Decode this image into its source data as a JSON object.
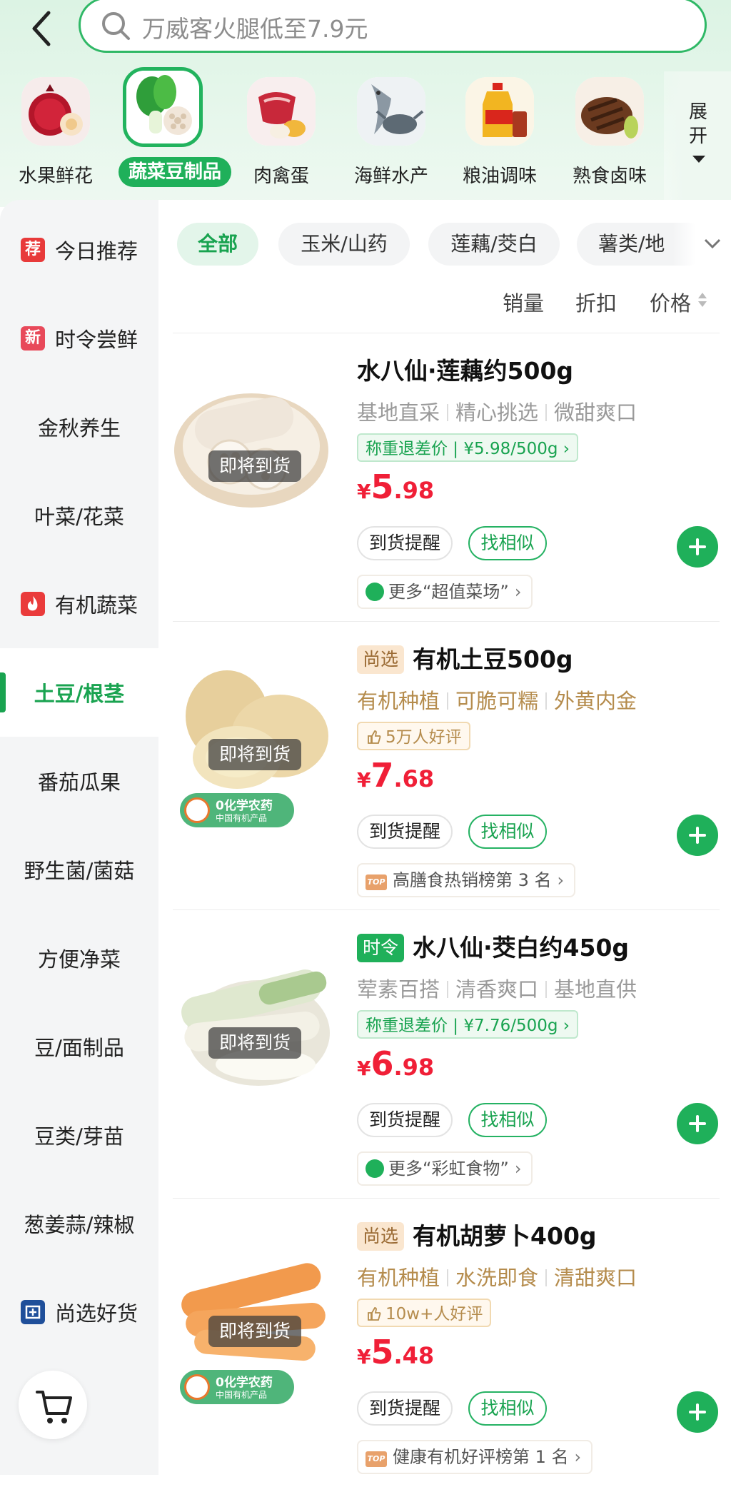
{
  "search": {
    "placeholder": "万威客火腿低至7.9元"
  },
  "categories": [
    {
      "label": "水果鲜花",
      "icon": "pomegranate-icon"
    },
    {
      "label": "蔬菜豆制品",
      "icon": "bok-choy-icon",
      "active": true
    },
    {
      "label": "肉禽蛋",
      "icon": "meat-icon"
    },
    {
      "label": "海鲜水产",
      "icon": "fish-icon"
    },
    {
      "label": "粮油调味",
      "icon": "oil-icon"
    },
    {
      "label": "熟食卤味",
      "icon": "braised-food-icon"
    }
  ],
  "expand": {
    "line1": "展",
    "line2": "开"
  },
  "sidebar": {
    "items": [
      {
        "label": "今日推荐",
        "badge": "荐"
      },
      {
        "label": "时令尝鲜",
        "badge": "新"
      },
      {
        "label": "金秋养生"
      },
      {
        "label": "叶菜/花菜"
      },
      {
        "label": "有机蔬菜",
        "badge": "fire"
      },
      {
        "label": "土豆/根茎",
        "active": true
      },
      {
        "label": "番茄瓜果"
      },
      {
        "label": "野生菌/菌菇"
      },
      {
        "label": "方便净菜"
      },
      {
        "label": "豆/面制品"
      },
      {
        "label": "豆类/芽苗"
      },
      {
        "label": "葱姜蒜/辣椒"
      },
      {
        "label": "尚选好货",
        "badge": "box"
      }
    ]
  },
  "filters": {
    "chips": [
      "全部",
      "玉米/山药",
      "莲藕/茭白",
      "薯类/地"
    ],
    "sorts": [
      "销量",
      "折扣",
      "价格"
    ]
  },
  "products": [
    {
      "title": "水八仙·莲藕约500g",
      "tag": "",
      "desc": [
        "基地直采",
        "精心挑选",
        "微甜爽口"
      ],
      "pill": "称重退差价 | ¥5.98/500g",
      "pill_style": "green",
      "price_symbol": "¥",
      "price_int": "5",
      "price_dec": ".98",
      "status": "即将到货",
      "notify": "到货提醒",
      "similar": "找相似",
      "more": "更多“超值菜场”",
      "more_icon": "basket-icon"
    },
    {
      "title": "有机土豆500g",
      "tag": "尚选",
      "desc": [
        "有机种植",
        "可脆可糯",
        "外黄内金"
      ],
      "pill": "5万人好评",
      "pill_style": "gold",
      "price_symbol": "¥",
      "price_int": "7",
      "price_dec": ".68",
      "status": "即将到货",
      "organic_l1": "0化学农药",
      "organic_l2": "中国有机产品",
      "notify": "到货提醒",
      "similar": "找相似",
      "more": "高膳食热销榜第 3 名",
      "more_icon": "top-icon",
      "top_label": "TOP"
    },
    {
      "title": "水八仙·茭白约450g",
      "tag": "时令",
      "desc": [
        "荤素百搭",
        "清香爽口",
        "基地直供"
      ],
      "pill": "称重退差价 | ¥7.76/500g",
      "pill_style": "green",
      "price_symbol": "¥",
      "price_int": "6",
      "price_dec": ".98",
      "status": "即将到货",
      "notify": "到货提醒",
      "similar": "找相似",
      "more": "更多“彩虹食物”",
      "more_icon": "basket-icon"
    },
    {
      "title": "有机胡萝卜400g",
      "tag": "尚选",
      "desc": [
        "有机种植",
        "水洗即食",
        "清甜爽口"
      ],
      "pill": "10w+人好评",
      "pill_style": "gold",
      "price_symbol": "¥",
      "price_int": "5",
      "price_dec": ".48",
      "status": "即将到货",
      "organic_l1": "0化学农药",
      "organic_l2": "中国有机产品",
      "notify": "到货提醒",
      "similar": "找相似",
      "more": "健康有机好评榜第 1 名",
      "more_icon": "top-icon",
      "top_label": "TOP"
    }
  ],
  "colors": {
    "accent": "#1fb05a",
    "price": "#f01f37",
    "gold": "#b58c4d"
  }
}
